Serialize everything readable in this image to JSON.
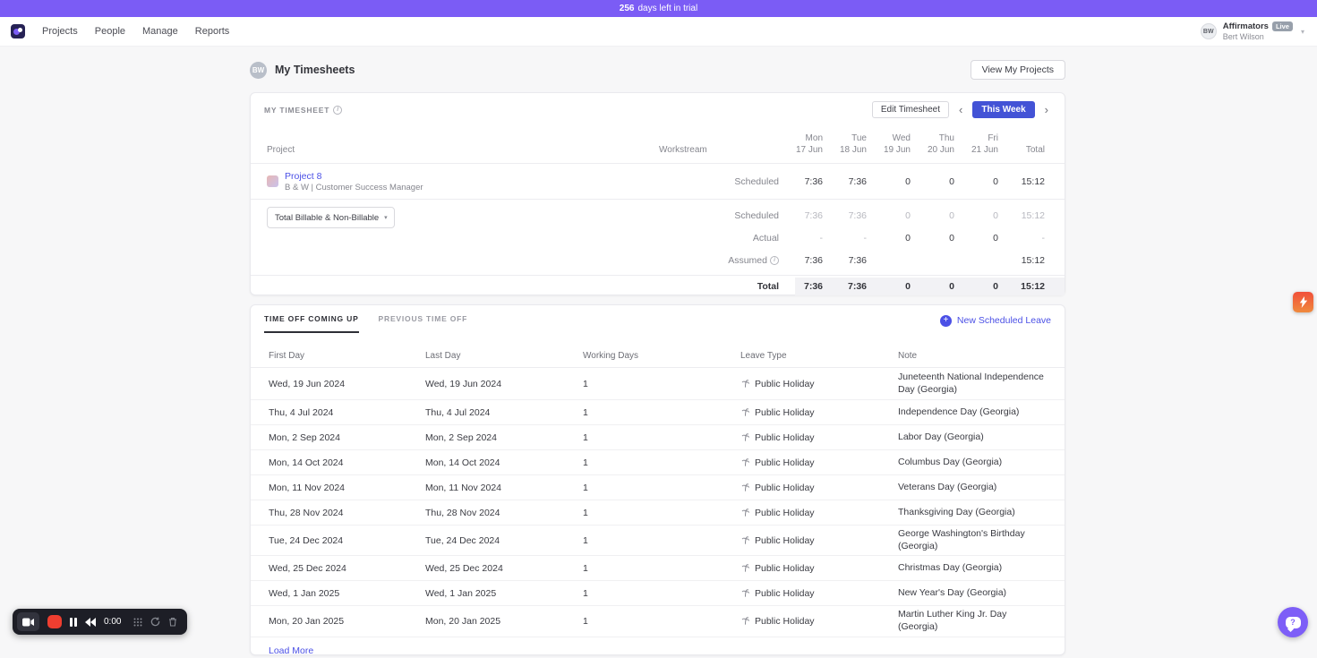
{
  "banner": {
    "days": "256",
    "rest": "days left in trial"
  },
  "nav": {
    "items": [
      "Projects",
      "People",
      "Manage",
      "Reports"
    ]
  },
  "account": {
    "initials": "BW",
    "org": "Affirmators",
    "badge": "Live",
    "name": "Bert Wilson"
  },
  "header": {
    "initials": "BW",
    "title": "My Timesheets",
    "view_projects": "View My Projects"
  },
  "timesheet": {
    "label": "My Timesheet",
    "edit": "Edit Timesheet",
    "week": "This Week",
    "col_project": "Project",
    "col_workstream": "Workstream",
    "col_total": "Total",
    "days": [
      {
        "day": "Mon",
        "date": "17 Jun"
      },
      {
        "day": "Tue",
        "date": "18 Jun"
      },
      {
        "day": "Wed",
        "date": "19 Jun"
      },
      {
        "day": "Thu",
        "date": "20 Jun"
      },
      {
        "day": "Fri",
        "date": "21 Jun"
      }
    ],
    "project": {
      "name": "Project 8",
      "subtitle": "B & W | Customer Success Manager",
      "type": "Scheduled",
      "values": [
        "7:36",
        "7:36",
        "0",
        "0",
        "0",
        "15:12"
      ]
    },
    "filter": "Total Billable & Non-Billable",
    "rows": {
      "scheduled": {
        "label": "Scheduled",
        "values": [
          "7:36",
          "7:36",
          "0",
          "0",
          "0",
          "15:12"
        ]
      },
      "actual": {
        "label": "Actual",
        "values": [
          "-",
          "-",
          "0",
          "0",
          "0",
          "-"
        ]
      },
      "assumed": {
        "label": "Assumed",
        "values": [
          "7:36",
          "7:36",
          "",
          "",
          "",
          "15:12"
        ]
      }
    },
    "total": {
      "label": "Total",
      "values": [
        "7:36",
        "7:36",
        "0",
        "0",
        "0",
        "15:12"
      ]
    }
  },
  "timeoff": {
    "tab_upcoming": "Time Off Coming Up",
    "tab_previous": "Previous Time Off",
    "new_leave": "New Scheduled Leave",
    "columns": [
      "First Day",
      "Last Day",
      "Working Days",
      "Leave Type",
      "Note"
    ],
    "rows": [
      {
        "first_day": "Wed, 19 Jun 2024",
        "last_day": "Wed, 19 Jun 2024",
        "working_days": "1",
        "leave_type": "Public Holiday",
        "note": "Juneteenth National Independence Day (Georgia)"
      },
      {
        "first_day": "Thu, 4 Jul 2024",
        "last_day": "Thu, 4 Jul 2024",
        "working_days": "1",
        "leave_type": "Public Holiday",
        "note": "Independence Day (Georgia)"
      },
      {
        "first_day": "Mon, 2 Sep 2024",
        "last_day": "Mon, 2 Sep 2024",
        "working_days": "1",
        "leave_type": "Public Holiday",
        "note": "Labor Day (Georgia)"
      },
      {
        "first_day": "Mon, 14 Oct 2024",
        "last_day": "Mon, 14 Oct 2024",
        "working_days": "1",
        "leave_type": "Public Holiday",
        "note": "Columbus Day (Georgia)"
      },
      {
        "first_day": "Mon, 11 Nov 2024",
        "last_day": "Mon, 11 Nov 2024",
        "working_days": "1",
        "leave_type": "Public Holiday",
        "note": "Veterans Day (Georgia)"
      },
      {
        "first_day": "Thu, 28 Nov 2024",
        "last_day": "Thu, 28 Nov 2024",
        "working_days": "1",
        "leave_type": "Public Holiday",
        "note": "Thanksgiving Day (Georgia)"
      },
      {
        "first_day": "Tue, 24 Dec 2024",
        "last_day": "Tue, 24 Dec 2024",
        "working_days": "1",
        "leave_type": "Public Holiday",
        "note": "George Washington's Birthday (Georgia)"
      },
      {
        "first_day": "Wed, 25 Dec 2024",
        "last_day": "Wed, 25 Dec 2024",
        "working_days": "1",
        "leave_type": "Public Holiday",
        "note": "Christmas Day (Georgia)"
      },
      {
        "first_day": "Wed, 1 Jan 2025",
        "last_day": "Wed, 1 Jan 2025",
        "working_days": "1",
        "leave_type": "Public Holiday",
        "note": "New Year's Day (Georgia)"
      },
      {
        "first_day": "Mon, 20 Jan 2025",
        "last_day": "Mon, 20 Jan 2025",
        "working_days": "1",
        "leave_type": "Public Holiday",
        "note": "Martin Luther King Jr. Day (Georgia)"
      }
    ],
    "load_more": "Load More"
  },
  "recorder": {
    "time": "0:00"
  },
  "icons": {
    "info": "i",
    "chevron_left": "‹",
    "chevron_right": "›",
    "chevron_down": "▾",
    "plus": "+",
    "help": "?"
  },
  "colors": {
    "banner_purple": "#7b5cf5",
    "accent_indigo": "#4b50e6",
    "week_button_blue": "#4353d6",
    "record_red": "#ef3e30",
    "widget_orange": "#f1503a",
    "help_purple": "#7d5ef7"
  }
}
